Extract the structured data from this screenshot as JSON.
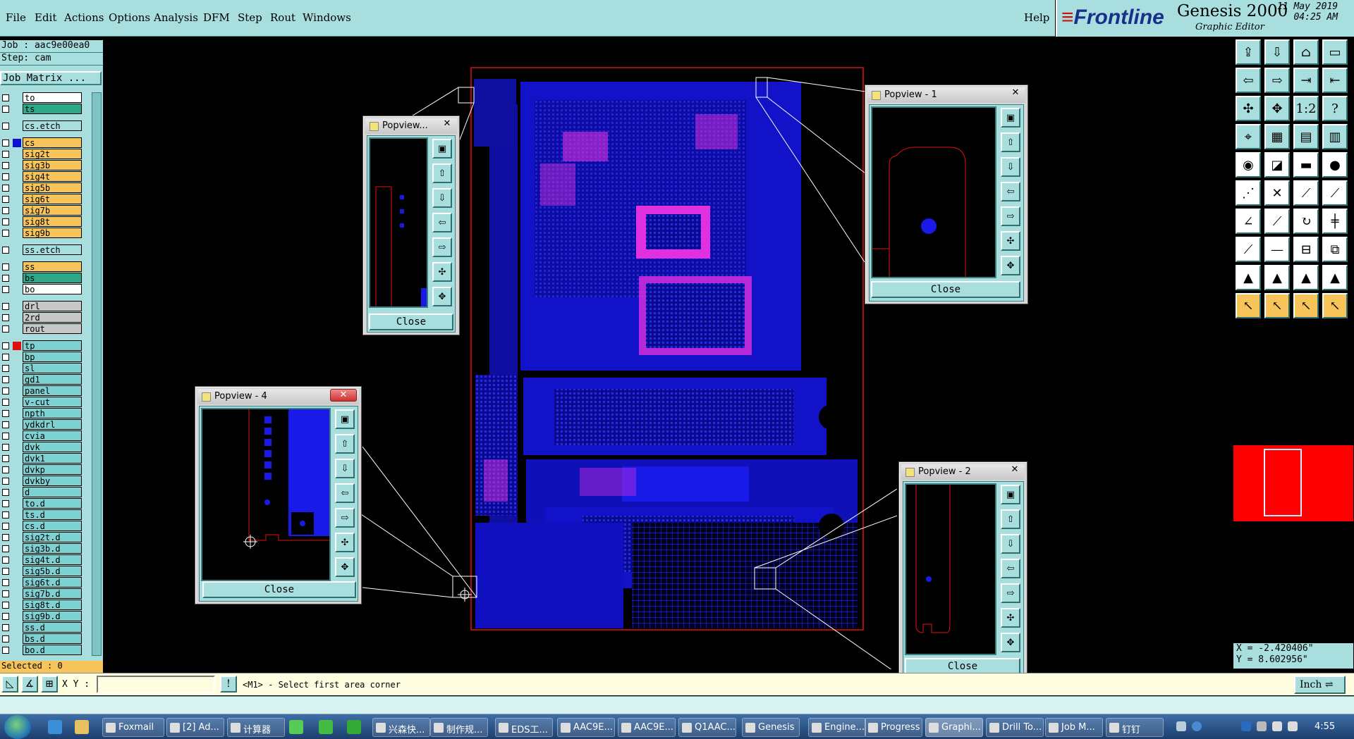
{
  "menu": [
    "File",
    "Edit",
    "Actions",
    "Options",
    "Analysis",
    "DFM",
    "Step",
    "Rout",
    "Windows"
  ],
  "help": "Help",
  "brand": {
    "logo": "Frontline",
    "product": "Genesis 2000",
    "subtitle": "Graphic Editor",
    "date": "11 May 2019",
    "time": "04:25 AM"
  },
  "job": {
    "job_line": "Job : aac9e00ea0",
    "step_line": "Step: cam",
    "matrix_button": "Job Matrix ..."
  },
  "layers": [
    {
      "name": "to",
      "color": "#ffffff",
      "arrow": "↲"
    },
    {
      "name": "ts",
      "color": "#2ea889",
      "arrow": "↲"
    },
    {
      "name": "cs.etch",
      "color": "#a8dede"
    },
    {
      "name": "cs",
      "color": "#f7c45a",
      "sw": "#1010d0"
    },
    {
      "name": "sig2t",
      "color": "#f7c45a"
    },
    {
      "name": "sig3b",
      "color": "#f7c45a"
    },
    {
      "name": "sig4t",
      "color": "#f7c45a"
    },
    {
      "name": "sig5b",
      "color": "#f7c45a"
    },
    {
      "name": "sig6t",
      "color": "#f7c45a"
    },
    {
      "name": "sig7b",
      "color": "#f7c45a"
    },
    {
      "name": "sig8t",
      "color": "#f7c45a"
    },
    {
      "name": "sig9b",
      "color": "#f7c45a"
    },
    {
      "name": "ss.etch",
      "color": "#a8dede"
    },
    {
      "name": "ss",
      "color": "#f7c45a"
    },
    {
      "name": "bs",
      "color": "#2ea889",
      "arrow": "↲"
    },
    {
      "name": "bo",
      "color": "#ffffff",
      "arrow": "↲"
    },
    {
      "name": "drl",
      "color": "#c8c8c8"
    },
    {
      "name": "2rd",
      "color": "#c8c8c8"
    },
    {
      "name": "rout",
      "color": "#c8c8c8"
    },
    {
      "name": "tp",
      "color": "#7fd0d0",
      "sw": "#e01010",
      "arrow": "↲"
    },
    {
      "name": "bp",
      "color": "#7fd0d0",
      "arrow": "↲"
    },
    {
      "name": "sl",
      "color": "#7fd0d0"
    },
    {
      "name": "gd1",
      "color": "#7fd0d0",
      "arrow": "↲"
    },
    {
      "name": "panel",
      "color": "#7fd0d0",
      "arrow": "↲"
    },
    {
      "name": "v-cut",
      "color": "#7fd0d0"
    },
    {
      "name": "npth",
      "color": "#7fd0d0"
    },
    {
      "name": "ydkdrl",
      "color": "#7fd0d0"
    },
    {
      "name": "cvia",
      "color": "#7fd0d0"
    },
    {
      "name": "dvk",
      "color": "#7fd0d0"
    },
    {
      "name": "dvk1",
      "color": "#7fd0d0"
    },
    {
      "name": "dvkp",
      "color": "#7fd0d0"
    },
    {
      "name": "dvkby",
      "color": "#7fd0d0"
    },
    {
      "name": "d",
      "color": "#7fd0d0"
    },
    {
      "name": "to.d",
      "color": "#7fd0d0",
      "arrow": "↲"
    },
    {
      "name": "ts.d",
      "color": "#7fd0d0",
      "arrow": "↲"
    },
    {
      "name": "cs.d",
      "color": "#7fd0d0"
    },
    {
      "name": "sig2t.d",
      "color": "#7fd0d0"
    },
    {
      "name": "sig3b.d",
      "color": "#7fd0d0"
    },
    {
      "name": "sig4t.d",
      "color": "#7fd0d0"
    },
    {
      "name": "sig5b.d",
      "color": "#7fd0d0"
    },
    {
      "name": "sig6t.d",
      "color": "#7fd0d0"
    },
    {
      "name": "sig7b.d",
      "color": "#7fd0d0"
    },
    {
      "name": "sig8t.d",
      "color": "#7fd0d0"
    },
    {
      "name": "sig9b.d",
      "color": "#7fd0d0"
    },
    {
      "name": "ss.d",
      "color": "#7fd0d0"
    },
    {
      "name": "bs.d",
      "color": "#7fd0d0",
      "arrow": "↲"
    },
    {
      "name": "bo.d",
      "color": "#7fd0d0",
      "arrow": "↲"
    }
  ],
  "selected": "Selected : 0",
  "popviews": {
    "p1": {
      "title": "Popview - 1",
      "close": "Close"
    },
    "p2": {
      "title": "Popview - 2",
      "close": "Close"
    },
    "p3": {
      "title": "Popview...",
      "close": "Close"
    },
    "p4": {
      "title": "Popview - 4",
      "close": "Close"
    }
  },
  "coords": {
    "x": "X = -2.420406\"",
    "y": "Y = 8.602956\""
  },
  "command": {
    "xy_label": "X Y :",
    "message": "<M1> - Select first area corner",
    "unit": "Inch"
  },
  "taskbar": {
    "items": [
      "Foxmail",
      "[2] Ad...",
      "计算器",
      "",
      "",
      "",
      "兴森快...",
      "制作规...",
      "EDS工...",
      "AAC9E...",
      "AAC9E...",
      "Q1AAC...",
      "Genesis",
      "Engine...",
      "Progress",
      "Graphi...",
      "Drill To...",
      "Job M...",
      "钉钉"
    ],
    "clock": "4:55"
  },
  "colors": {
    "panel": "#a8dede",
    "trace": "#1010d0",
    "pad": "#e030e0",
    "outline": "#e01010"
  }
}
